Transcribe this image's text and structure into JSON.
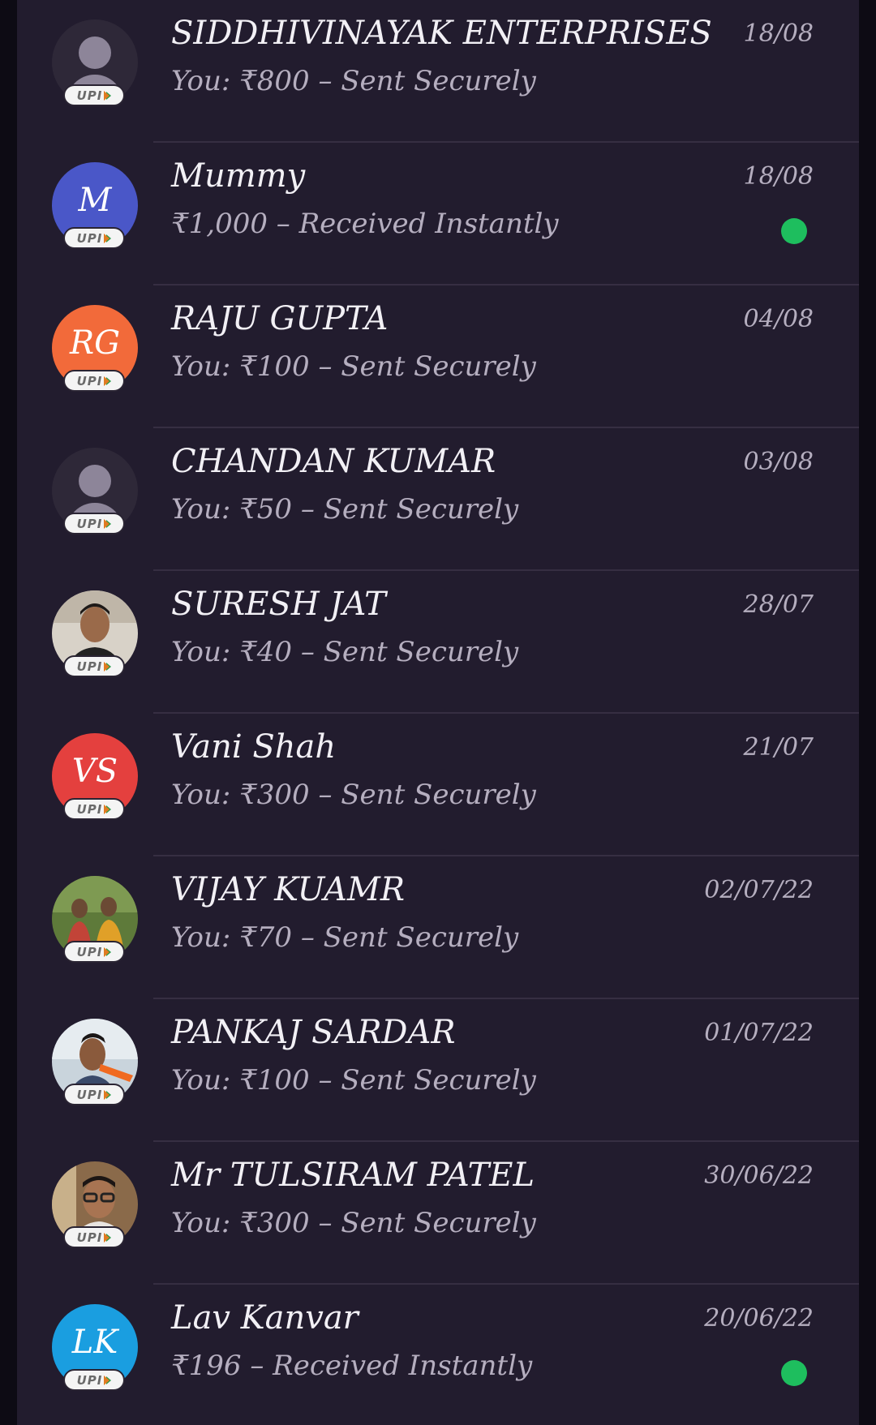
{
  "transactions": [
    {
      "name": "SIDDHIVINAYAK ENTERPRISES",
      "summary": "You: ₹800 – Sent Securely",
      "date": "18/08",
      "avatar": {
        "type": "default"
      },
      "badge": "UPI",
      "unread": false
    },
    {
      "name": "Mummy",
      "summary": "₹1,000 – Received Instantly",
      "date": "18/08",
      "avatar": {
        "type": "initials",
        "initials": "M",
        "color": "#4a57c8"
      },
      "badge": "UPI",
      "unread": true
    },
    {
      "name": "RAJU  GUPTA",
      "summary": "You: ₹100 – Sent Securely",
      "date": "04/08",
      "avatar": {
        "type": "initials",
        "initials": "RG",
        "color": "#f26a3a"
      },
      "badge": "UPI",
      "unread": false
    },
    {
      "name": "CHANDAN KUMAR",
      "summary": "You: ₹50 – Sent Securely",
      "date": "03/08",
      "avatar": {
        "type": "default"
      },
      "badge": "UPI",
      "unread": false
    },
    {
      "name": "SURESH JAT",
      "summary": "You: ₹40 – Sent Securely",
      "date": "28/07",
      "avatar": {
        "type": "photo"
      },
      "badge": "UPI",
      "unread": false
    },
    {
      "name": "Vani Shah",
      "summary": "You: ₹300 – Sent Securely",
      "date": "21/07",
      "avatar": {
        "type": "initials",
        "initials": "VS",
        "color": "#e4403e"
      },
      "badge": "UPI",
      "unread": false
    },
    {
      "name": "VIJAY  KUAMR",
      "summary": "You: ₹70 – Sent Securely",
      "date": "02/07/22",
      "avatar": {
        "type": "photo"
      },
      "badge": "UPI",
      "unread": false
    },
    {
      "name": "PANKAJ  SARDAR",
      "summary": "You: ₹100 – Sent Securely",
      "date": "01/07/22",
      "avatar": {
        "type": "photo"
      },
      "badge": "UPI",
      "unread": false
    },
    {
      "name": "Mr TULSIRAM  PATEL",
      "summary": "You: ₹300 – Sent Securely",
      "date": "30/06/22",
      "avatar": {
        "type": "photo"
      },
      "badge": "UPI",
      "unread": false
    },
    {
      "name": "Lav Kanvar",
      "summary": "₹196 – Received Instantly",
      "date": "20/06/22",
      "avatar": {
        "type": "initials",
        "initials": "LK",
        "color": "#1a9ee0"
      },
      "badge": "UPI",
      "unread": true
    }
  ],
  "colors": {
    "background": "#221c2e",
    "unread_dot": "#1ebe5e",
    "text_primary": "#f2f0f5",
    "text_secondary": "#b5aebf"
  }
}
